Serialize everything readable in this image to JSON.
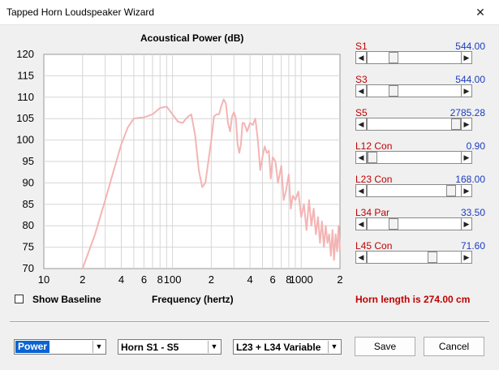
{
  "window": {
    "title": "Tapped Horn Loudspeaker Wizard",
    "close_glyph": "✕"
  },
  "chart_data": {
    "type": "line",
    "title": "Acoustical Power (dB)",
    "xlabel": "Frequency (hertz)",
    "ylabel": "",
    "xscale": "log",
    "xlim": [
      10,
      2000
    ],
    "ylim": [
      70,
      120
    ],
    "grid": true,
    "x_tick_labels": [
      "10",
      "2",
      "4",
      "6",
      "8",
      "100",
      "2",
      "4",
      "6",
      "8",
      "1000",
      "2"
    ],
    "x_tick_values": [
      10,
      20,
      40,
      60,
      80,
      100,
      200,
      400,
      600,
      800,
      1000,
      2000
    ],
    "y_ticks": [
      70,
      75,
      80,
      85,
      90,
      95,
      100,
      105,
      110,
      115,
      120
    ],
    "series": [
      {
        "color": "#f4b4b4",
        "x": [
          20,
          25,
          30,
          35,
          40,
          45,
          50,
          55,
          60,
          70,
          80,
          90,
          100,
          110,
          120,
          130,
          140,
          150,
          160,
          170,
          180,
          190,
          200,
          210,
          220,
          230,
          240,
          250,
          260,
          270,
          280,
          290,
          300,
          310,
          320,
          330,
          340,
          350,
          360,
          380,
          400,
          420,
          440,
          460,
          480,
          500,
          520,
          540,
          560,
          580,
          600,
          630,
          660,
          700,
          730,
          760,
          800,
          830,
          860,
          900,
          950,
          1000,
          1050,
          1100,
          1150,
          1200,
          1250,
          1300,
          1350,
          1400,
          1450,
          1500,
          1550,
          1600,
          1650,
          1700,
          1750,
          1800,
          1850,
          1900,
          1950,
          2000
        ],
        "y": [
          70,
          78,
          86,
          93,
          99,
          103,
          105,
          105.2,
          105.3,
          106,
          107.5,
          107.8,
          106,
          104.3,
          104,
          105.3,
          106,
          101,
          93,
          89,
          90,
          95,
          100,
          105.5,
          106,
          106,
          108,
          109.5,
          108.5,
          104,
          102,
          105.5,
          106.5,
          105.2,
          99,
          97,
          99,
          104,
          104,
          102,
          104,
          103.5,
          105,
          100,
          93,
          96,
          98.5,
          97,
          97.5,
          91,
          96,
          95,
          90,
          94,
          86,
          88,
          92,
          84,
          87,
          86,
          88,
          82,
          85,
          79,
          86,
          80,
          84,
          78,
          82,
          76,
          81,
          75,
          80,
          76,
          78,
          73,
          79,
          72,
          78,
          74,
          80,
          74
        ]
      }
    ]
  },
  "sliders": [
    {
      "name": "s1",
      "label": "S1",
      "value": "544.00",
      "position": 0.25
    },
    {
      "name": "s3",
      "label": "S3",
      "value": "544.00",
      "position": 0.25
    },
    {
      "name": "s5",
      "label": "S5",
      "value": "2785.28",
      "position": 1.0
    },
    {
      "name": "l12",
      "label": "L12  Con",
      "value": "0.90",
      "position": 0.0
    },
    {
      "name": "l23",
      "label": "L23  Con",
      "value": "168.00",
      "position": 0.94
    },
    {
      "name": "l34",
      "label": "L34  Par",
      "value": "33.50",
      "position": 0.25
    },
    {
      "name": "l45",
      "label": "L45  Con",
      "value": "71.60",
      "position": 0.72
    }
  ],
  "show_baseline": {
    "label": "Show Baseline",
    "checked": false
  },
  "horn_length": "Horn length is 274.00 cm",
  "combos": {
    "mode": "Power",
    "range": "Horn S1 - S5",
    "variable": "L23 + L34 Variable"
  },
  "buttons": {
    "save": "Save",
    "cancel": "Cancel"
  },
  "colors": {
    "accent_red": "#c00000",
    "value_blue": "#1a3cc0",
    "curve": "#f4b4b4",
    "selection": "#0a64d2"
  }
}
